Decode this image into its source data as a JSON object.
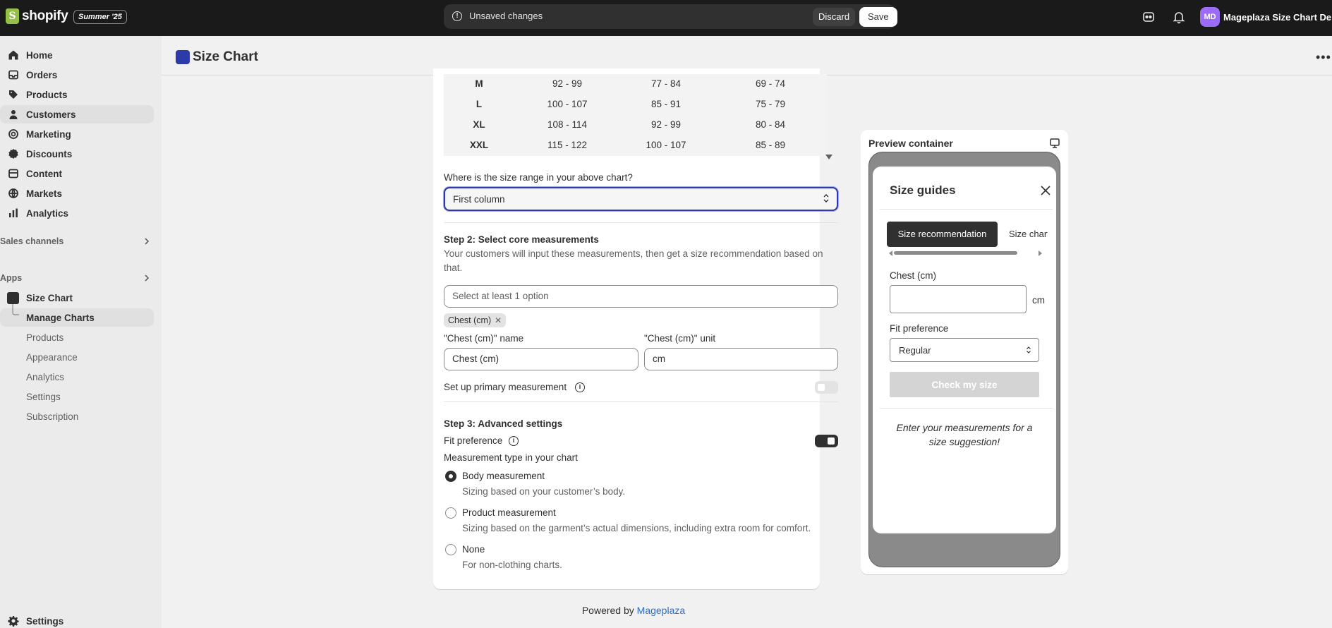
{
  "topbar": {
    "brand": "shopify",
    "edition": "Summer '25",
    "unsaved_text": "Unsaved changes",
    "discard_label": "Discard",
    "save_label": "Save",
    "store_initials": "MD",
    "store_name": "Mageplaza Size Chart De..."
  },
  "sidebar": {
    "items": [
      {
        "label": "Home",
        "icon": "home-icon"
      },
      {
        "label": "Orders",
        "icon": "orders-icon"
      },
      {
        "label": "Products",
        "icon": "tag-icon"
      },
      {
        "label": "Customers",
        "icon": "person-icon"
      },
      {
        "label": "Marketing",
        "icon": "target-icon"
      },
      {
        "label": "Discounts",
        "icon": "discount-icon"
      },
      {
        "label": "Content",
        "icon": "content-icon"
      },
      {
        "label": "Markets",
        "icon": "globe-icon"
      },
      {
        "label": "Analytics",
        "icon": "bar-chart-icon"
      }
    ],
    "sales_channels": "Sales channels",
    "apps": "Apps",
    "app_name": "Size Chart",
    "app_subitems": [
      "Manage Charts",
      "Products",
      "Appearance",
      "Analytics",
      "Settings",
      "Subscription"
    ],
    "settings": "Settings"
  },
  "header": {
    "title": "Size Chart"
  },
  "size_table": {
    "rows": [
      [
        "M",
        "92 - 99",
        "77 - 84",
        "69 - 74"
      ],
      [
        "L",
        "100 - 107",
        "85 - 91",
        "75 - 79"
      ],
      [
        "XL",
        "108 - 114",
        "92 - 99",
        "80 - 84"
      ],
      [
        "XXL",
        "115 - 122",
        "100 - 107",
        "85 - 89"
      ]
    ]
  },
  "form": {
    "size_range_label": "Where is the size range in your above chart?",
    "size_range_value": "First column",
    "step2_title": "Step 2: Select core measurements",
    "step2_help": "Your customers will input these measurements, then get a size recommendation based on that.",
    "measurement_placeholder": "Select at least 1 option",
    "tag": "Chest (cm)",
    "name_label": "\"Chest (cm)\" name",
    "name_value": "Chest (cm)",
    "unit_label": "\"Chest (cm)\" unit",
    "unit_value": "cm",
    "primary_label": "Set up primary measurement",
    "primary_on": false,
    "step3_title": "Step 3: Advanced settings",
    "fit_label": "Fit preference",
    "fit_on": true,
    "mtype_label": "Measurement type in your chart",
    "options": [
      {
        "label": "Body measurement",
        "help": "Sizing based on your customer’s body.",
        "checked": true
      },
      {
        "label": "Product measurement",
        "help": "Sizing based on the garment’s actual dimensions, including extra room for comfort.",
        "checked": false
      },
      {
        "label": "None",
        "help": "For non-clothing charts.",
        "checked": false
      }
    ]
  },
  "preview": {
    "title": "Preview container",
    "sg_title": "Size guides",
    "tab_active": "Size recommendation",
    "tab_other": "Size chart",
    "chest_label": "Chest (cm)",
    "unit": "cm",
    "fit_label": "Fit preference",
    "fit_value": "Regular",
    "button": "Check my size",
    "note": "Enter your measurements for a size suggestion!"
  },
  "footer": {
    "powered_prefix": "Powered by ",
    "powered_link": "Mageplaza"
  },
  "colors": {
    "topbar": "#1a1a1a",
    "accent_blue": "#2d3aa8",
    "link": "#2c6ecb"
  }
}
